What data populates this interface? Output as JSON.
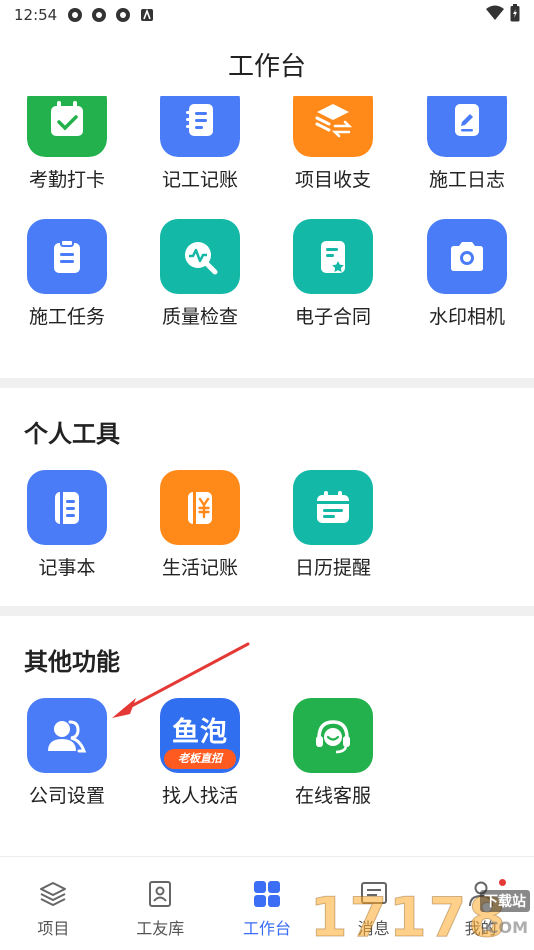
{
  "status": {
    "time": "12:54"
  },
  "page": {
    "title": "工作台"
  },
  "apps_top": [
    {
      "label": "考勤打卡",
      "icon": "calendar-check-icon",
      "color": "#22b14c"
    },
    {
      "label": "记工记账",
      "icon": "notebook-list-icon",
      "color": "#4a7cf7"
    },
    {
      "label": "项目收支",
      "icon": "layers-exchange-icon",
      "color": "#ff8a1a"
    },
    {
      "label": "施工日志",
      "icon": "pencil-doc-icon",
      "color": "#4a7cf7"
    },
    {
      "label": "施工任务",
      "icon": "clipboard-icon",
      "color": "#4a7cf7"
    },
    {
      "label": "质量检查",
      "icon": "search-pulse-icon",
      "color": "#14b8a6"
    },
    {
      "label": "电子合同",
      "icon": "contract-star-icon",
      "color": "#14b8a6"
    },
    {
      "label": "水印相机",
      "icon": "camera-icon",
      "color": "#4a7cf7"
    }
  ],
  "personal_tools": {
    "title": "个人工具",
    "items": [
      {
        "label": "记事本",
        "icon": "notebook-icon",
        "color": "#4a7cf7"
      },
      {
        "label": "生活记账",
        "icon": "yuan-ledger-icon",
        "color": "#ff8a1a"
      },
      {
        "label": "日历提醒",
        "icon": "calendar-icon",
        "color": "#14b8a6"
      }
    ]
  },
  "other_functions": {
    "title": "其他功能",
    "items": [
      {
        "label": "公司设置",
        "icon": "users-icon",
        "color": "#4a7cf7"
      },
      {
        "label": "找人找活",
        "icon": "yupao-logo-icon",
        "color": "#2f6ff0",
        "logo_text": "鱼泡",
        "logo_sub": "老板直招"
      },
      {
        "label": "在线客服",
        "icon": "headset-icon",
        "color": "#22b14c"
      }
    ]
  },
  "tabs": [
    {
      "label": "项目",
      "icon": "layers-icon",
      "active": false
    },
    {
      "label": "工友库",
      "icon": "contact-card-icon",
      "active": false
    },
    {
      "label": "工作台",
      "icon": "grid-icon",
      "active": true
    },
    {
      "label": "消息",
      "icon": "message-icon",
      "active": false
    },
    {
      "label": "我的",
      "icon": "user-icon",
      "active": false,
      "badge": true
    }
  ],
  "watermark": {
    "text": "17178",
    "sub": "下载站",
    "domain": ".COM"
  }
}
